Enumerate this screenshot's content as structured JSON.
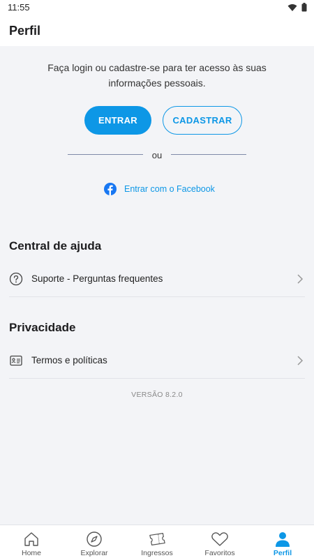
{
  "status_bar": {
    "time": "11:55"
  },
  "header": {
    "title": "Perfil"
  },
  "login": {
    "prompt": "Faça login ou cadastre-se para ter acesso às suas informações pessoais.",
    "enter_label": "ENTRAR",
    "register_label": "CADASTRAR",
    "or_text": "ou",
    "facebook_label": "Entrar com o Facebook"
  },
  "help": {
    "title": "Central de ajuda",
    "items": [
      {
        "label": "Suporte - Perguntas frequentes",
        "icon": "question-circle-icon"
      }
    ]
  },
  "privacy": {
    "title": "Privacidade",
    "items": [
      {
        "label": "Termos e políticas",
        "icon": "document-icon"
      }
    ]
  },
  "version": "VERSÃO 8.2.0",
  "bottom_nav": {
    "items": [
      {
        "label": "Home",
        "icon": "home-icon",
        "active": false
      },
      {
        "label": "Explorar",
        "icon": "compass-icon",
        "active": false
      },
      {
        "label": "Ingressos",
        "icon": "ticket-icon",
        "active": false
      },
      {
        "label": "Favoritos",
        "icon": "heart-icon",
        "active": false
      },
      {
        "label": "Perfil",
        "icon": "person-icon",
        "active": true
      }
    ]
  },
  "colors": {
    "accent": "#0d97e6",
    "background": "#f3f4f7",
    "facebook": "#1877f2"
  }
}
